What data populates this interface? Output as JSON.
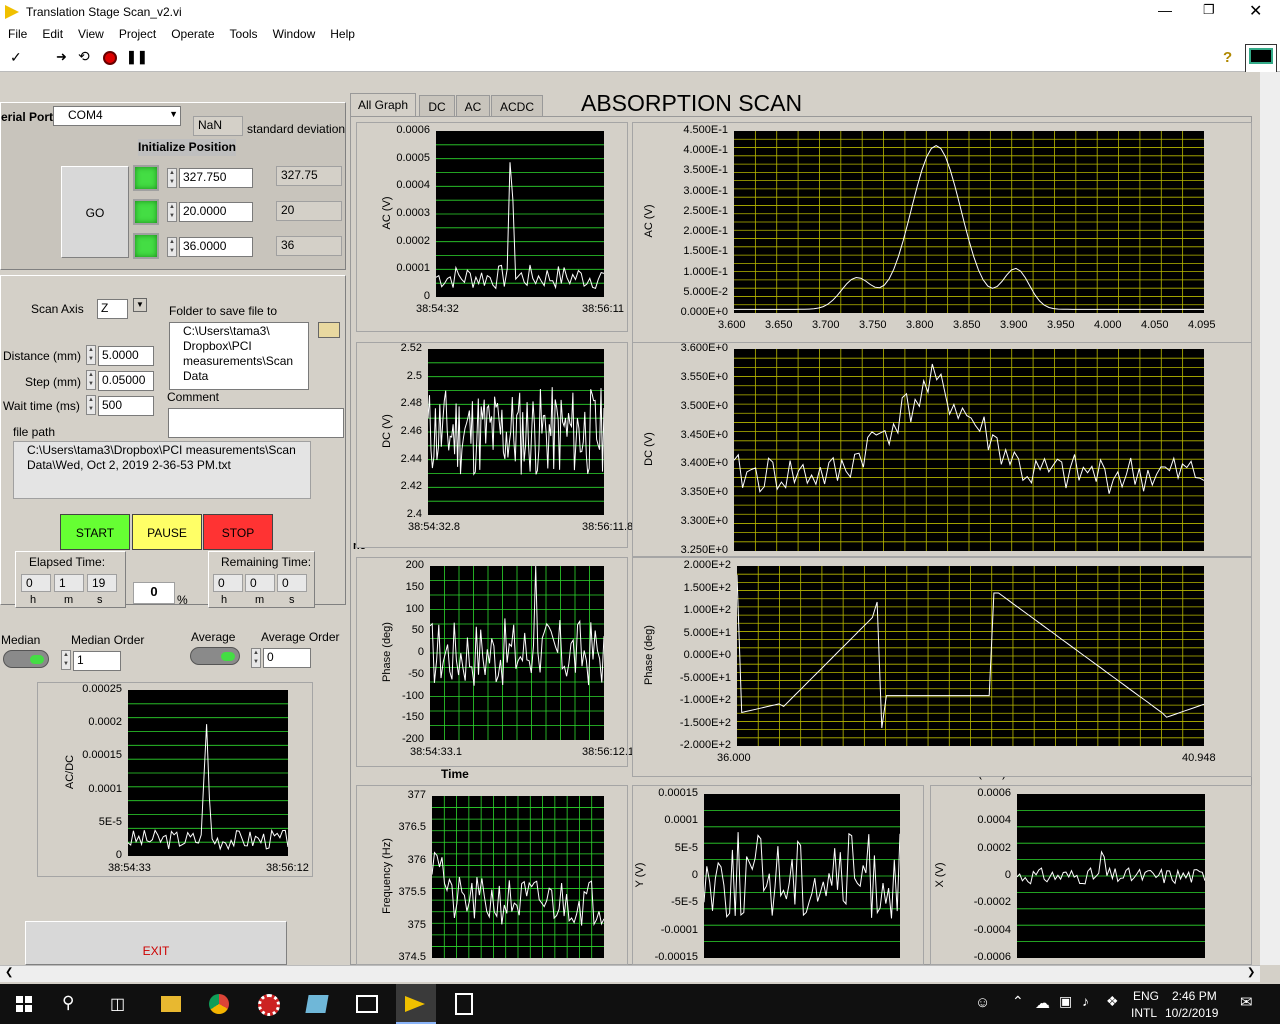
{
  "window": {
    "title": "Translation Stage Scan_v2.vi"
  },
  "menu": [
    "File",
    "Edit",
    "View",
    "Project",
    "Operate",
    "Tools",
    "Window",
    "Help"
  ],
  "serial": {
    "label": "erial Port",
    "value": "COM4",
    "nan": "NaN",
    "std_label": "standard deviation"
  },
  "init": {
    "label": "Initialize Position",
    "go": "GO",
    "rows": [
      {
        "input": "327.750",
        "display": "327.75"
      },
      {
        "input": "20.0000",
        "display": "20"
      },
      {
        "input": "36.0000",
        "display": "36"
      }
    ]
  },
  "scan": {
    "axis_label": "Scan Axis",
    "axis_value": "Z",
    "folder_label": "Folder to save file to",
    "folder_value": "C:\\Users\\tama3\\ Dropbox\\PCI measurements\\Scan Data",
    "distance_label": "Distance (mm)",
    "distance_value": "5.0000",
    "step_label": "Step (mm)",
    "step_value": "0.05000",
    "wait_label": "Wait time (ms)",
    "wait_value": "500",
    "comment_label": "Comment",
    "filepath_label": "file path",
    "filepath_value": "C:\\Users\\tama3\\Dropbox\\PCI measurements\\Scan Data\\Wed, Oct 2, 2019 2-36-53 PM.txt"
  },
  "controls": {
    "start": "START",
    "pause": "PAUSE",
    "stop": "STOP",
    "exit": "EXIT"
  },
  "elapsed": {
    "label": "Elapsed Time:",
    "h": "0",
    "m": "1",
    "s": "19"
  },
  "remaining": {
    "label": "Remaining Time:",
    "h": "0",
    "m": "0",
    "s": "0"
  },
  "units": {
    "h": "h",
    "m": "m",
    "s": "s"
  },
  "progress": {
    "value": "0",
    "unit": "%"
  },
  "filters": {
    "median_label": "Median",
    "median_order_label": "Median Order",
    "median_order": "1",
    "average_label": "Average",
    "average_order_label": "Average Order",
    "average_order": "0"
  },
  "tabs": [
    "All Graph",
    "DC",
    "AC",
    "ACDC"
  ],
  "heading": "ABSORPTION SCAN",
  "cut_label": "ne",
  "time_label": "Time",
  "distance_axis_label": "Distance (mm)",
  "colors": {
    "plot_bg": "#000000",
    "grid_green": "#2ed82e",
    "grid_yellow": "#b8b800",
    "trace": "#ffffff",
    "led": "#44dd44",
    "start": "#66ff33",
    "pause": "#ffff66",
    "stop": "#ff3333"
  },
  "graphs": {
    "acdc": {
      "ylabel": "AC/DC",
      "yticks": [
        "0.00025",
        "0.0002",
        "0.00015",
        "0.0001",
        "5E-5",
        "0"
      ],
      "x0": "38:54:33",
      "x1": "38:56:12"
    },
    "ac_time": {
      "ylabel": "AC (V)",
      "yticks": [
        "0.0006",
        "0.0005",
        "0.0004",
        "0.0003",
        "0.0002",
        "0.0001",
        "0"
      ],
      "x0": "38:54:32",
      "x1": "38:56:11"
    },
    "dc_time": {
      "ylabel": "DC (V)",
      "yticks": [
        "2.52",
        "2.5",
        "2.48",
        "2.46",
        "2.44",
        "2.42",
        "2.4"
      ],
      "x0": "38:54:32.8",
      "x1": "38:56:11.8"
    },
    "phase_time": {
      "ylabel": "Phase (deg)",
      "yticks": [
        "200",
        "150",
        "100",
        "50",
        "0",
        "-50",
        "-100",
        "-150",
        "-200"
      ],
      "x0": "38:54:33.1",
      "x1": "38:56:12.1"
    },
    "freq": {
      "ylabel": "Frequency (Hz)",
      "yticks": [
        "377",
        "376.5",
        "376",
        "375.5",
        "375",
        "374.5"
      ]
    },
    "y": {
      "ylabel": "Y (V)",
      "yticks": [
        "0.00015",
        "0.0001",
        "5E-5",
        "0",
        "-5E-5",
        "-0.0001",
        "-0.00015"
      ]
    },
    "x": {
      "ylabel": "X (V)",
      "yticks": [
        "0.0006",
        "0.0004",
        "0.0002",
        "0",
        "-0.0002",
        "-0.0004",
        "-0.0006"
      ]
    },
    "ac_dist": {
      "ylabel": "AC (V)",
      "yticks": [
        "4.500E-1",
        "4.000E-1",
        "3.500E-1",
        "3.000E-1",
        "2.500E-1",
        "2.000E-1",
        "1.500E-1",
        "1.000E-1",
        "5.000E-2",
        "0.000E+0"
      ],
      "xticks": [
        "3.600",
        "3.650",
        "3.700",
        "3.750",
        "3.800",
        "3.850",
        "3.900",
        "3.950",
        "4.000",
        "4.050",
        "4.095"
      ]
    },
    "dc_dist": {
      "ylabel": "DC (V)",
      "yticks": [
        "3.600E+0",
        "3.550E+0",
        "3.500E+0",
        "3.450E+0",
        "3.400E+0",
        "3.350E+0",
        "3.300E+0",
        "3.250E+0"
      ]
    },
    "phase_dist": {
      "ylabel": "Phase (deg)",
      "yticks": [
        "2.000E+2",
        "1.500E+2",
        "1.000E+2",
        "5.000E+1",
        "0.000E+0",
        "-5.000E+1",
        "-1.000E+2",
        "-1.500E+2",
        "-2.000E+2"
      ],
      "x0": "36.000",
      "x1": "40.948"
    }
  },
  "taskbar": {
    "lang1": "ENG",
    "lang2": "INTL",
    "time": "2:46 PM",
    "date": "10/2/2019"
  }
}
